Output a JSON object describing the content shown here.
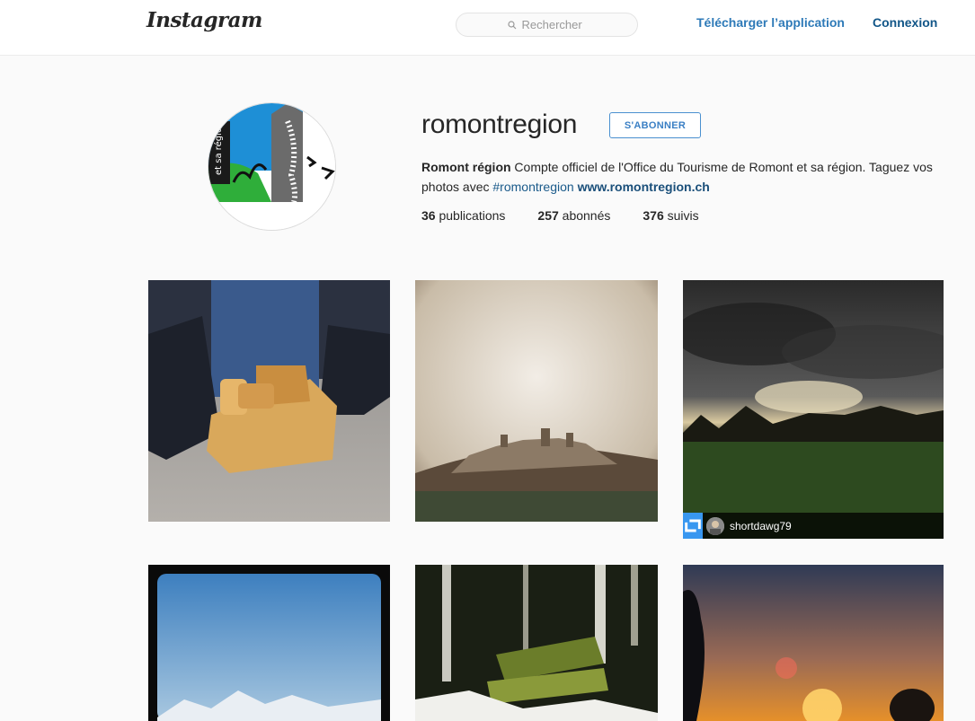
{
  "header": {
    "logo": "Instagram",
    "search_placeholder": "Rechercher",
    "download_label": "Télécharger l’application",
    "login_label": "Connexion"
  },
  "profile": {
    "username": "romontregion",
    "follow_label": "S'ABONNER",
    "display_name": "Romont région",
    "bio_text": " Compte officiel de l'Office du Tourisme de Romont et sa région. Taguez vos photos avec ",
    "hashtag": "#romontregion",
    "website": "www.romontregion.ch",
    "stats": [
      {
        "count": "36",
        "label": " publications"
      },
      {
        "count": "257",
        "label": " abonnés"
      },
      {
        "count": "376",
        "label": " suivis"
      }
    ]
  },
  "posts": [
    {
      "subject": "wooden-toy-photo"
    },
    {
      "subject": "romont-hilltop-town-photo"
    },
    {
      "subject": "cloudy-sunset-field-photo",
      "repost_user": "shortdawg79"
    },
    {
      "subject": "alps-sky-photo"
    },
    {
      "subject": "mossy-bench-forest-photo"
    },
    {
      "subject": "sunset-tree-photo"
    }
  ],
  "colors": {
    "accent_blue": "#3897f0",
    "link_dark": "#125688",
    "background": "#fafafa"
  }
}
